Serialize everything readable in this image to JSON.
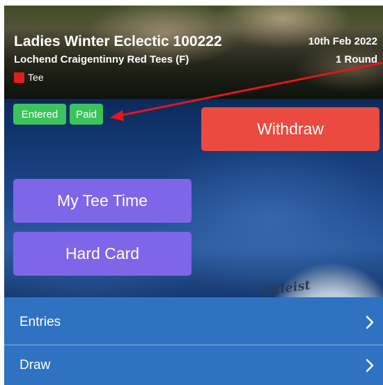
{
  "competition": {
    "title": "Ladies Winter Eclectic 100222",
    "course": "Lochend Craigentinny Red Tees (F)",
    "tee_label": "Tee",
    "tee_color": "#e01e1e",
    "date": "10th Feb 2022",
    "rounds": "1 Round"
  },
  "status_badges": {
    "entered": "Entered",
    "paid": "Paid",
    "color": "#3cc45c"
  },
  "actions": {
    "withdraw": "Withdraw",
    "withdraw_color": "#ea4a3f",
    "my_tee_time": "My Tee Time",
    "hard_card": "Hard Card",
    "primary_color": "#7e66e8"
  },
  "background_ball_brand": "Titleist",
  "menu": {
    "items": [
      {
        "label": "Entries",
        "icon": "chevron-right-icon"
      },
      {
        "label": "Draw",
        "icon": "chevron-right-icon"
      }
    ],
    "row_color": "#2f72c2"
  },
  "annotation_arrow_color": "#e3161b"
}
